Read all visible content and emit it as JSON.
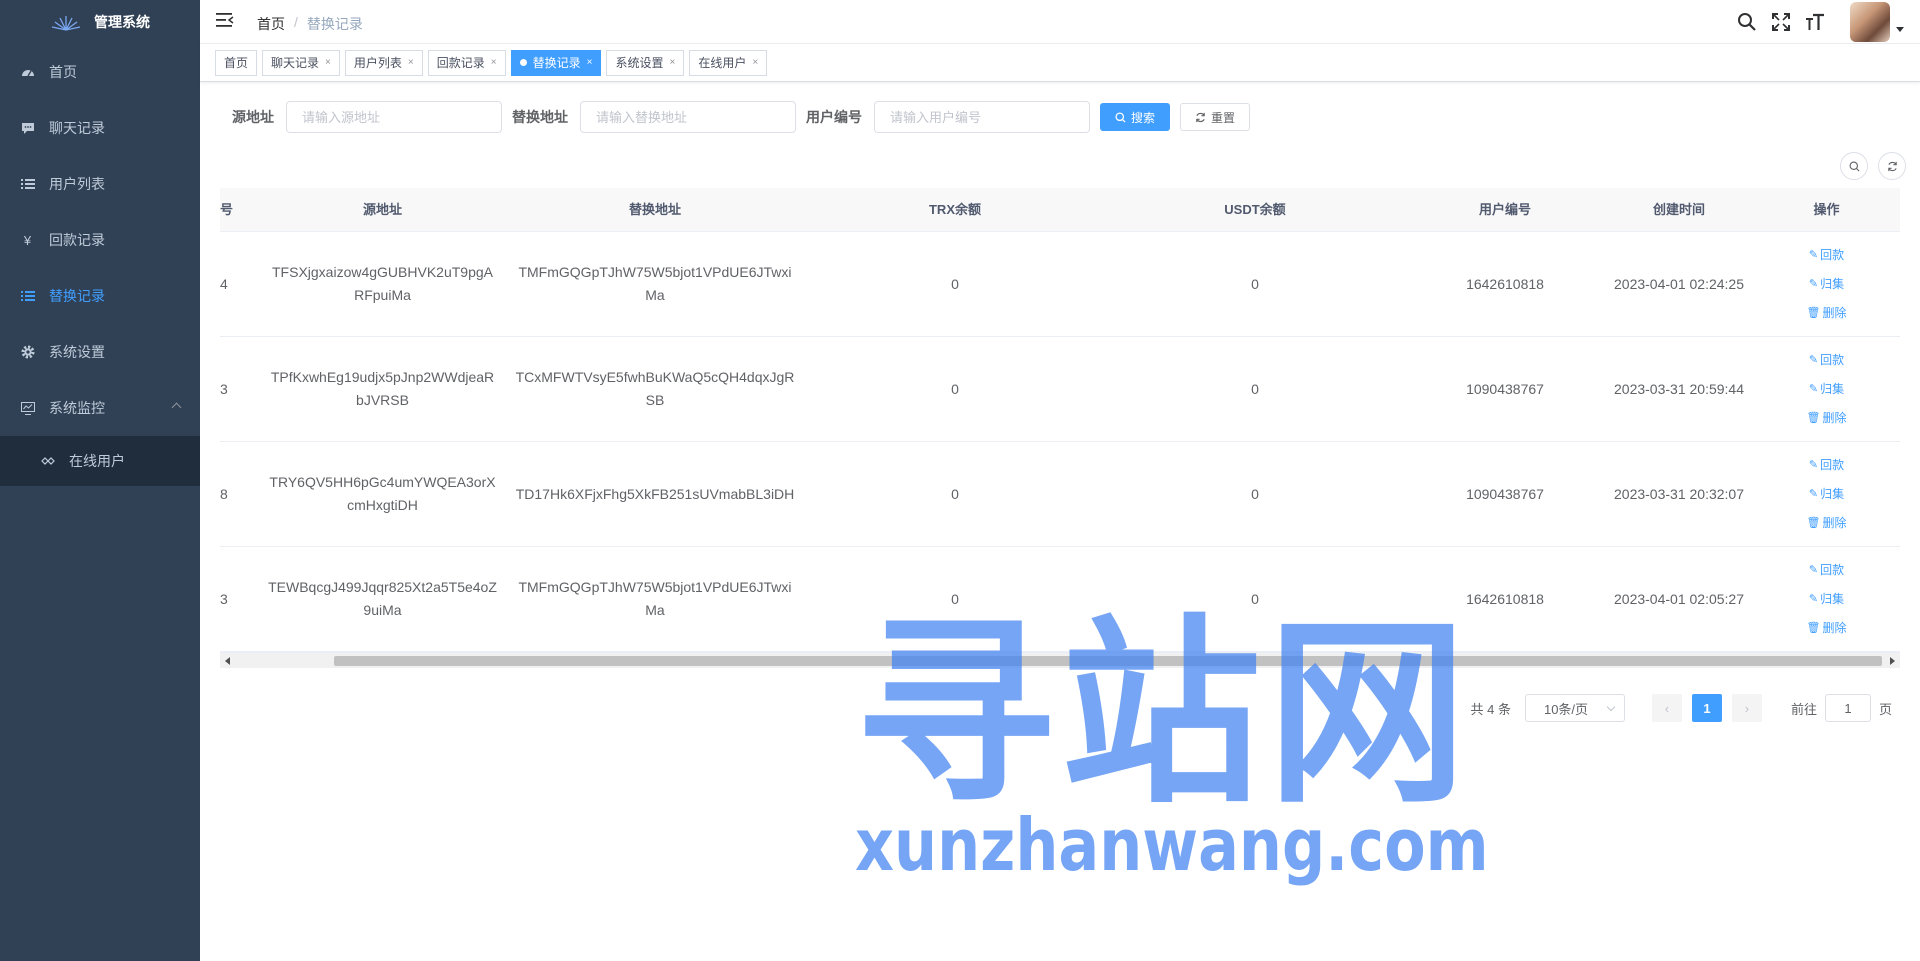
{
  "app": {
    "title": "管理系统"
  },
  "sidebar": {
    "items": [
      {
        "label": "首页",
        "icon": "dashboard-icon"
      },
      {
        "label": "聊天记录",
        "icon": "message-icon"
      },
      {
        "label": "用户列表",
        "icon": "list-icon"
      },
      {
        "label": "回款记录",
        "icon": "yuan-icon"
      },
      {
        "label": "替换记录",
        "icon": "list-icon",
        "active": true
      },
      {
        "label": "系统设置",
        "icon": "gear-icon"
      },
      {
        "label": "系统监控",
        "icon": "monitor-icon",
        "expanded": true
      }
    ],
    "submenu": [
      {
        "label": "在线用户",
        "icon": "online-icon"
      }
    ]
  },
  "breadcrumb": {
    "home": "首页",
    "separator": "/",
    "current": "替换记录"
  },
  "tags": [
    {
      "label": "首页"
    },
    {
      "label": "聊天记录",
      "close": "×"
    },
    {
      "label": "用户列表",
      "close": "×"
    },
    {
      "label": "回款记录",
      "close": "×"
    },
    {
      "label": "替换记录",
      "close": "×",
      "active": true
    },
    {
      "label": "系统设置",
      "close": "×"
    },
    {
      "label": "在线用户",
      "close": "×"
    }
  ],
  "search": {
    "source_label": "源地址",
    "source_placeholder": "请输入源地址",
    "target_label": "替换地址",
    "target_placeholder": "请输入替换地址",
    "uid_label": "用户编号",
    "uid_placeholder": "请输入用户编号",
    "search_button": "搜索",
    "reset_button": "重置"
  },
  "table": {
    "columns": [
      "号",
      "源地址",
      "替换地址",
      "TRX余额",
      "USDT余额",
      "用户编号",
      "创建时间",
      "操作"
    ],
    "rows": [
      {
        "id": "4",
        "src": "TFSXjgxaizow4gGUBHVK2uT9pgARFpuiMa",
        "dst": "TMFmGQGpTJhW75W5bjot1VPdUE6JTwxiMa",
        "trx": "0",
        "usdt": "0",
        "uid": "1642610818",
        "time": "2023-04-01 02:24:25"
      },
      {
        "id": "3",
        "src": "TPfKxwhEg19udjx5pJnp2WWdjeaRbJVRSB",
        "dst": "TCxMFWTVsyE5fwhBuKWaQ5cQH4dqxJgRSB",
        "trx": "0",
        "usdt": "0",
        "uid": "1090438767",
        "time": "2023-03-31 20:59:44"
      },
      {
        "id": "8",
        "src": "TRY6QV5HH6pGc4umYWQEA3orXcmHxgtiDH",
        "dst": "TD17Hk6XFjxFhg5XkFB251sUVmabBL3iDH",
        "trx": "0",
        "usdt": "0",
        "uid": "1090438767",
        "time": "2023-03-31 20:32:07"
      },
      {
        "id": "3",
        "src": "TEWBqcgJ499Jqqr825Xt2a5T5e4oZ9uiMa",
        "dst": "TMFmGQGpTJhW75W5bjot1VPdUE6JTwxiMa",
        "trx": "0",
        "usdt": "0",
        "uid": "1642610818",
        "time": "2023-04-01 02:05:27"
      }
    ],
    "ops": {
      "refund": "回款",
      "collect": "归集",
      "delete": "删除"
    }
  },
  "pagination": {
    "total": "共 4 条",
    "page_size": "10条/页",
    "current": "1",
    "goto_prefix": "前往",
    "goto_value": "1",
    "goto_suffix": "页",
    "prev": "‹",
    "next": "›"
  },
  "watermark": {
    "cn": "寻站网",
    "en": "xunzhanwang.com"
  },
  "colors": {
    "sidebar_bg": "#304156",
    "accent": "#409eff",
    "submenu_bg": "#1f2d3d"
  }
}
